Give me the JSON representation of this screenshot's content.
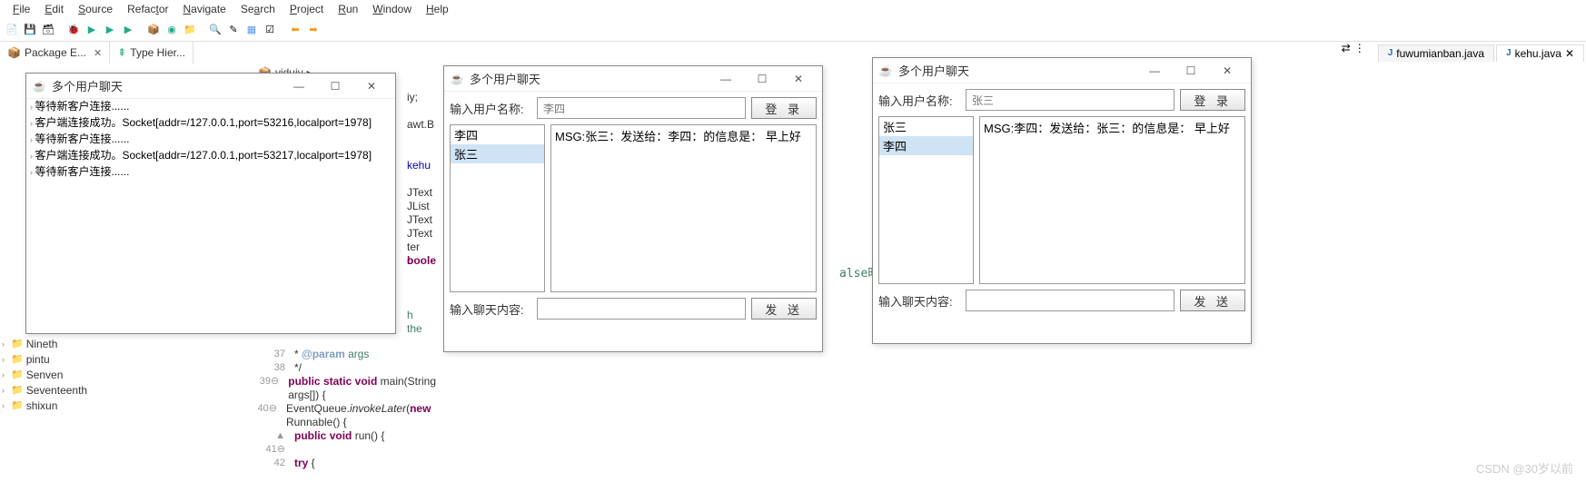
{
  "menu": [
    "File",
    "Edit",
    "Source",
    "Refactor",
    "Navigate",
    "Search",
    "Project",
    "Run",
    "Window",
    "Help"
  ],
  "views": {
    "package_explorer": "Package E...",
    "type_hierarchy": "Type Hier..."
  },
  "editor_tabs": [
    {
      "label": "fuwumianban.java",
      "active": false
    },
    {
      "label": "kehu.java",
      "active": true
    }
  ],
  "breadcrumb": {
    "pkg": "yiduiy",
    "dots": "..."
  },
  "tree_items": [
    "Nineth",
    "pintu",
    "Senven",
    "Seventeenth",
    "shixun"
  ],
  "code_fragments": {
    "l1": "iy;",
    "l2": "awt.B",
    "l3": "kehu",
    "l4": "JText",
    "l5": "JList",
    "l6": "JText",
    "l7": "JText",
    "l8a": "ter o",
    "l8b": "boole",
    "l9": "h the",
    "false_tail": "alse时表"
  },
  "code_lines": [
    {
      "n": "37",
      "html": " * <span class='tag'>@param</span> <span class='cm'>args</span>"
    },
    {
      "n": "38",
      "html": " */"
    },
    {
      "n": "39⊖",
      "html": "<span class='kw'>public</span> <span class='kw'>static</span> <span class='kw'>void</span> main(String args[]) {"
    },
    {
      "n": "40⊖",
      "html": "    EventQueue.<span class='st'>invokeLater</span>(<span class='kw'>new</span> Runnable() {"
    },
    {
      "n": "▲ 41⊖",
      "html": "        <span class='kw'>public</span> <span class='kw'>void</span> run() {"
    },
    {
      "n": "42",
      "html": "            <span class='kw'>try</span> {"
    }
  ],
  "server_window": {
    "title": "多个用户聊天",
    "log": [
      "等待新客户连接......",
      "客户端连接成功。Socket[addr=/127.0.0.1,port=53216,localport=1978]",
      "等待新客户连接......",
      "客户端连接成功。Socket[addr=/127.0.0.1,port=53217,localport=1978]",
      "等待新客户连接......"
    ]
  },
  "client1": {
    "title": "多个用户聊天",
    "name_label": "输入用户名称:",
    "name_value": "李四",
    "login_btn": "登 录",
    "users": [
      {
        "name": "李四",
        "sel": false
      },
      {
        "name": "张三",
        "sel": true
      }
    ],
    "msg": "MSG:张三：发送给：李四：的信息是： 早上好",
    "chat_label": "输入聊天内容:",
    "send_btn": "发 送"
  },
  "client2": {
    "title": "多个用户聊天",
    "name_label": "输入用户名称:",
    "name_value": "张三",
    "login_btn": "登 录",
    "users": [
      {
        "name": "张三",
        "sel": false
      },
      {
        "name": "李四",
        "sel": true
      }
    ],
    "msg": "MSG:李四：发送给：张三：的信息是： 早上好",
    "chat_label": "输入聊天内容:",
    "send_btn": "发 送"
  },
  "watermark": "CSDN @30岁以前"
}
